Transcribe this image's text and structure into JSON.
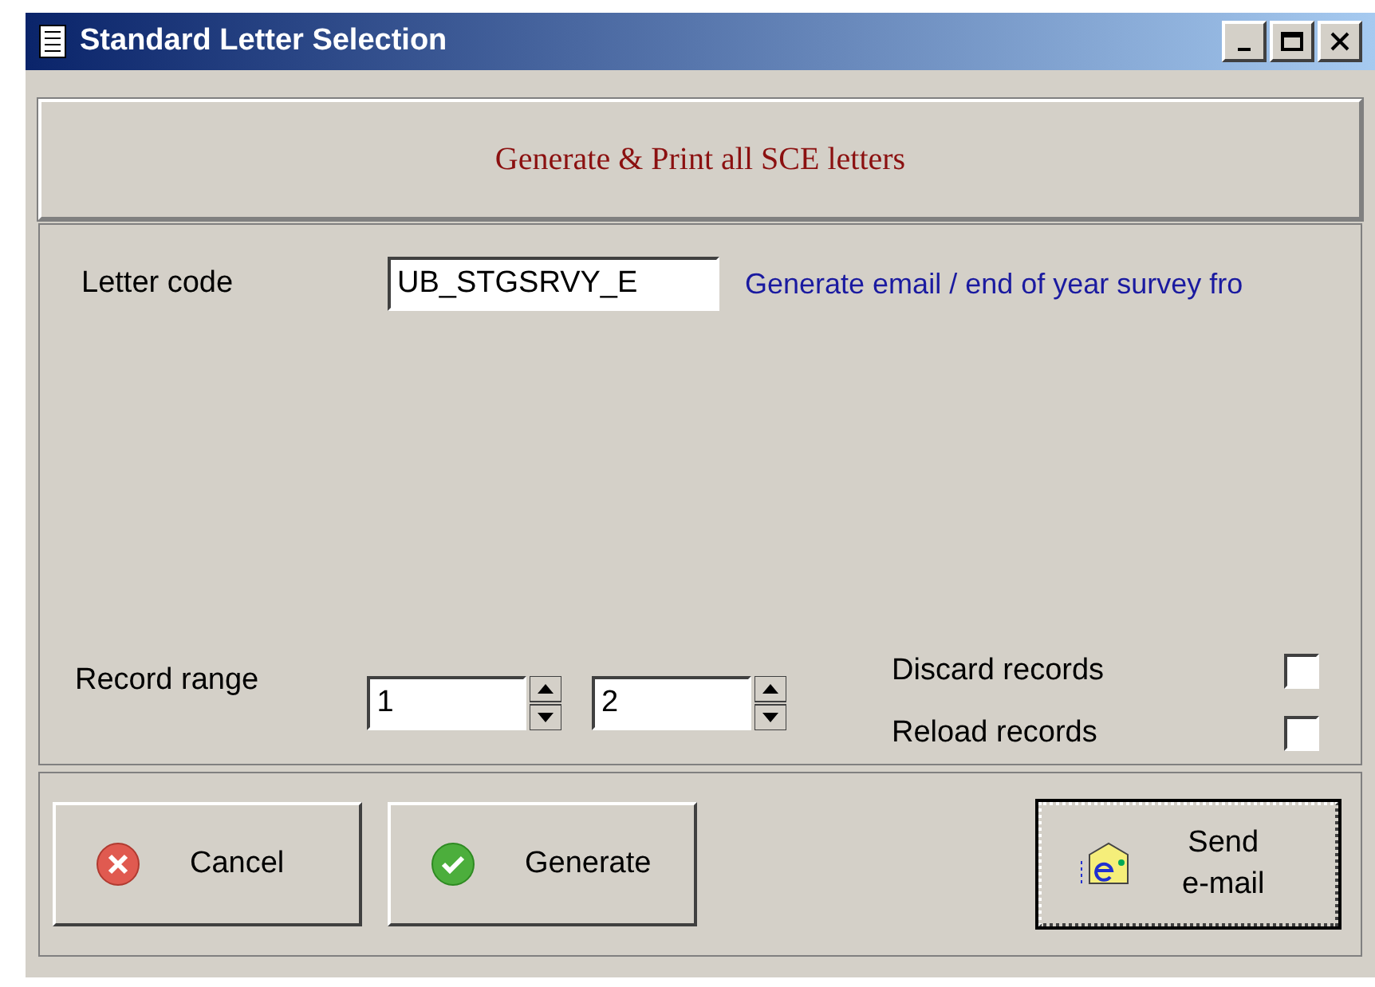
{
  "window": {
    "title": "Standard Letter Selection"
  },
  "heading": "Generate & Print all SCE letters",
  "letter_code": {
    "label": "Letter code",
    "value": "UB_STGSRVY_E",
    "description": "Generate email / end of year survey fro"
  },
  "record_range": {
    "label": "Record range",
    "from": "1",
    "to": "2"
  },
  "options": [
    {
      "label": "Discard records",
      "checked": false
    },
    {
      "label": "Reload records",
      "checked": false
    }
  ],
  "buttons": [
    {
      "kind": "cancel",
      "label": "Cancel",
      "default": false
    },
    {
      "kind": "generate",
      "label": "Generate",
      "default": false
    },
    {
      "kind": "email",
      "lines": [
        "Send",
        "e-mail"
      ],
      "default": true
    }
  ]
}
